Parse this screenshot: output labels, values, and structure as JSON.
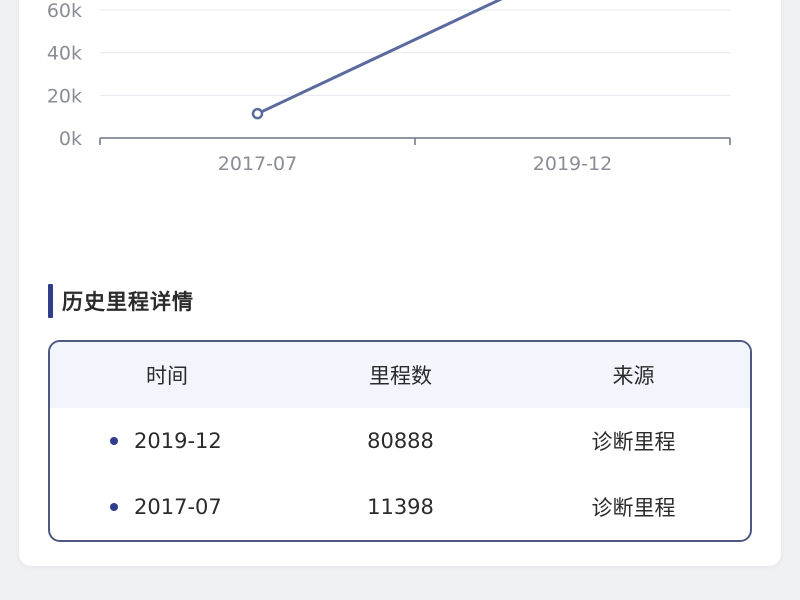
{
  "chart_data": {
    "type": "line",
    "categories": [
      "2017-07",
      "2019-12"
    ],
    "series": [
      {
        "values": [
          11398,
          80888
        ]
      }
    ],
    "ylim": [
      0,
      60000
    ],
    "yticks": [
      "0k",
      "20k",
      "40k",
      "60k"
    ],
    "grid": true,
    "color": "#5b6a9e"
  },
  "section": {
    "title": "历史里程详情"
  },
  "table": {
    "headers": [
      "时间",
      "里程数",
      "来源"
    ],
    "rows": [
      {
        "time": "2019-12",
        "mileage": "80888",
        "source": "诊断里程"
      },
      {
        "time": "2017-07",
        "mileage": "11398",
        "source": "诊断里程"
      }
    ]
  },
  "colors": {
    "accent": "#2f3d8c",
    "line": "#5b6a9e",
    "table_border": "#4f5880",
    "header_bg": "#f3f5fc"
  }
}
